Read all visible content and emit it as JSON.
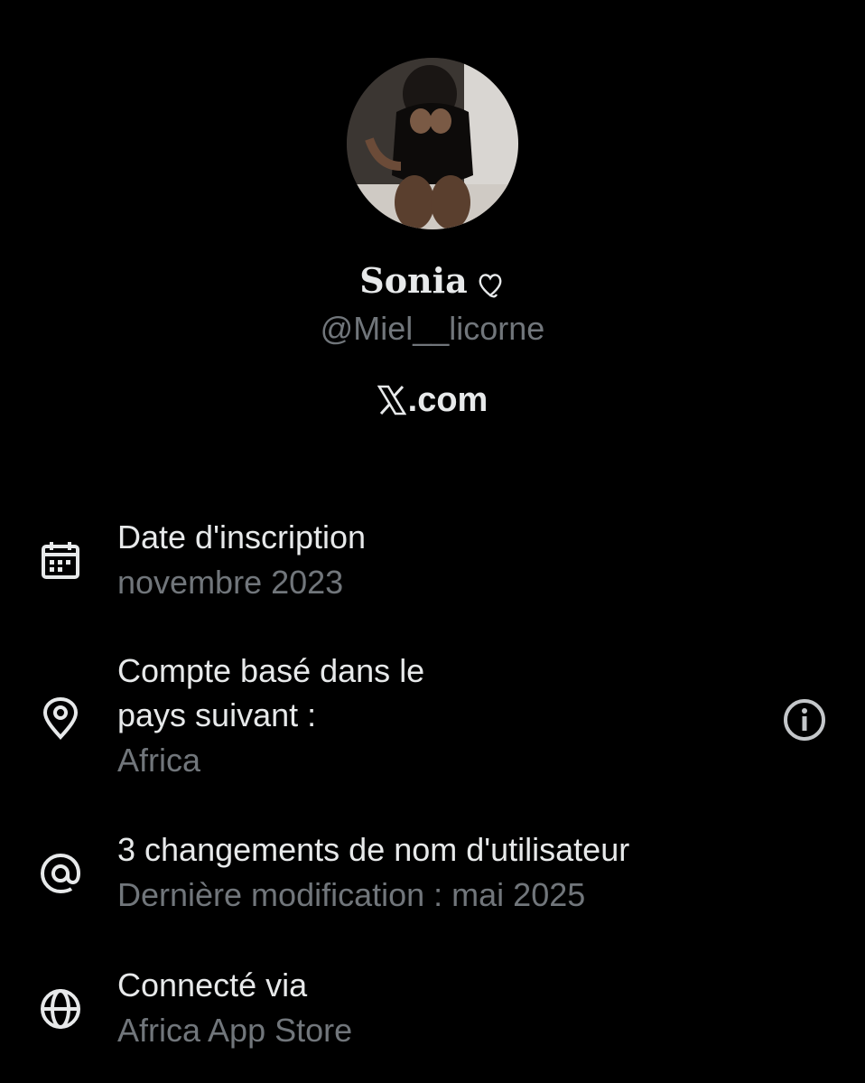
{
  "profile": {
    "display_name": "Sonia",
    "handle": "@Miel__licorne",
    "brand": ".com"
  },
  "details": [
    {
      "icon": "calendar-icon",
      "title": "Date d'inscription",
      "subtitle": "novembre 2023"
    },
    {
      "icon": "location-pin-icon",
      "title": "Compte basé dans le pays suivant :",
      "subtitle": "Africa"
    },
    {
      "icon": "at-sign-icon",
      "title": "3 changements de nom d'utilisateur",
      "subtitle": "Dernière modification : mai 2025"
    },
    {
      "icon": "globe-icon",
      "title": "Connecté via",
      "subtitle": "Africa App Store"
    }
  ],
  "colors": {
    "background": "#000000",
    "primary_text": "#e7e9ea",
    "secondary_text": "#71767b"
  }
}
